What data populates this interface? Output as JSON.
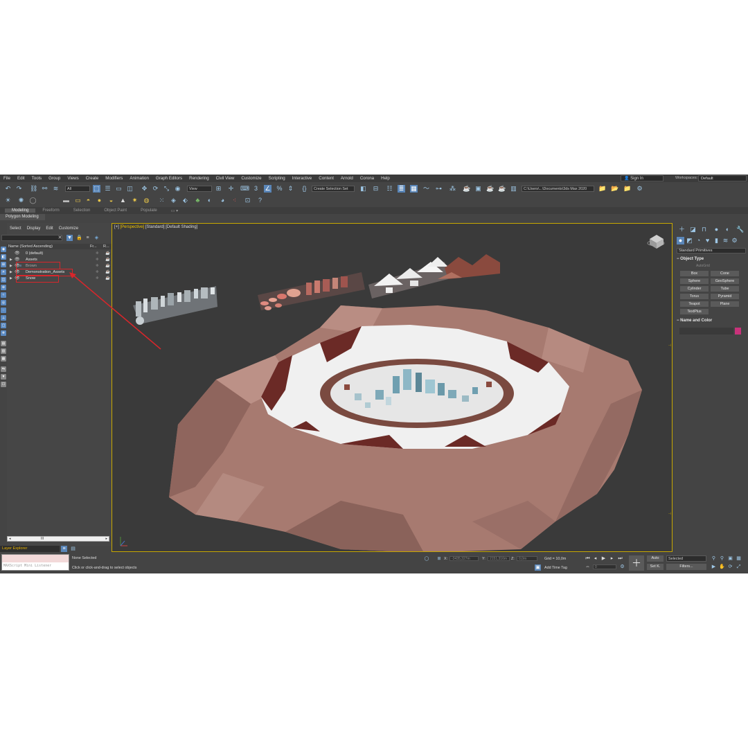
{
  "menu": [
    "File",
    "Edit",
    "Tools",
    "Group",
    "Views",
    "Create",
    "Modifiers",
    "Animation",
    "Graph Editors",
    "Rendering",
    "Civil View",
    "Customize",
    "Scripting",
    "Interactive",
    "Content",
    "Arnold",
    "Corona",
    "Help"
  ],
  "signin": "Sign In",
  "workspace": {
    "label": "Workspaces:",
    "value": "Default"
  },
  "toolbar": {
    "filter": "All",
    "view": "View",
    "selection_set": "Create Selection Set",
    "path": "C:\\Users\\...\\Documents\\3ds Max 2020"
  },
  "ribbon": {
    "tabs": [
      "Modeling",
      "Freeform",
      "Selection",
      "Object Paint",
      "Populate"
    ],
    "sub": "Polygon Modeling"
  },
  "explorer": {
    "menu": [
      "Select",
      "Display",
      "Edit",
      "Customize"
    ],
    "header": {
      "name": "Name (Sorted Ascending)",
      "col1": "Fr...",
      "col2": "R..."
    },
    "rows": [
      {
        "name": "0 (default)"
      },
      {
        "name": "Assets"
      },
      {
        "name": "Brown"
      },
      {
        "name": "Demonstration_Assets"
      },
      {
        "name": "Snow"
      }
    ],
    "scroll_label": "III",
    "layer_explorer": "Layer Explorer"
  },
  "viewport": {
    "label_plus": "[+]",
    "label_view": "[Perspective]",
    "label_std": "[Standard]",
    "label_shading": "[Default Shading]"
  },
  "cmdpanel": {
    "dropdown": "Standard Primitives",
    "object_type": "Object Type",
    "autogrid": "AutoGrid",
    "primitives": [
      "Box",
      "Cone",
      "Sphere",
      "GeoSphere",
      "Cylinder",
      "Tube",
      "Torus",
      "Pyramid",
      "Teapot",
      "Plane",
      "TextPlus"
    ],
    "name_color": "Name and Color"
  },
  "status": {
    "maxscript": "MAXScript Mini Listener",
    "selected": "None Selected",
    "hint": "Click or click-and-drag to select objects"
  },
  "bottom": {
    "x_label": "X:",
    "x_val": "-3435,327m",
    "y_label": "Y:",
    "y_val": "2151,316m",
    "z_label": "Z:",
    "z_val": "0,0m",
    "grid": "Grid = 10,0m",
    "add_time_tag": "Add Time Tag",
    "auto": "Auto",
    "selected_dd": "Selected",
    "setk": "Set K.",
    "filters": "Filters...",
    "frame": "0"
  },
  "colors": {
    "highlight": "#5a86b8",
    "viewport_border": "#c8a800",
    "annotation": "#d9262b",
    "brown": "#a77a70",
    "snow": "#f0f0f0"
  }
}
